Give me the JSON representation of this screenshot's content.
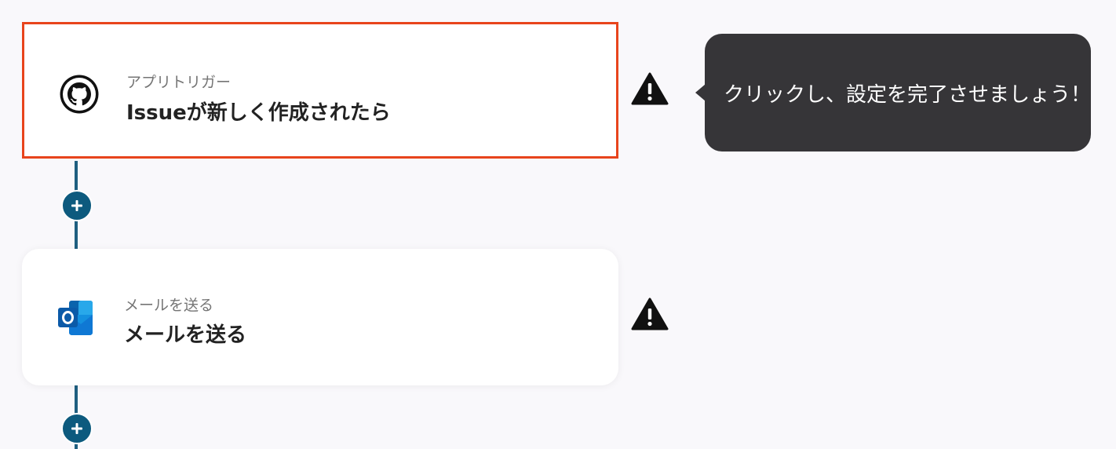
{
  "flow": {
    "trigger": {
      "label": "アプリトリガー",
      "title": "Issueが新しく作成されたら",
      "icon": "github-icon",
      "highlight_color": "#e8441c"
    },
    "action": {
      "label": "メールを送る",
      "title": "メールを送る",
      "icon": "outlook-icon"
    },
    "connector_color": "#1f5f80",
    "add_button_color": "#0d5a7e",
    "warning_icon": "warning-icon"
  },
  "tooltip": {
    "text": "クリックし、設定を完了させましょう！",
    "background": "#363538"
  }
}
